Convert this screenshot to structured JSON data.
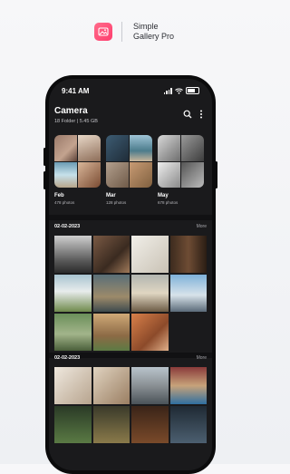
{
  "brand": {
    "line1": "Simple",
    "line2": "Gallery Pro"
  },
  "status": {
    "time": "9:41 AM"
  },
  "header": {
    "title": "Camera",
    "subtitle": "18 Folder | 5.45 GB"
  },
  "albums": [
    {
      "name": "Feb",
      "count": "478 photos"
    },
    {
      "name": "Mar",
      "count": "128 photos"
    },
    {
      "name": "May",
      "count": "678 photos"
    }
  ],
  "sections": [
    {
      "date": "02-02-2023",
      "more": "More"
    },
    {
      "date": "02-02-2023",
      "more": "More"
    }
  ],
  "colors": {
    "accent": "#ff4d73",
    "background": "#1a1a1c",
    "phone": "#0b0b0c"
  },
  "icons": [
    "image-icon",
    "search-icon",
    "more-vert-icon",
    "signal-icon",
    "wifi-icon",
    "battery-icon"
  ]
}
